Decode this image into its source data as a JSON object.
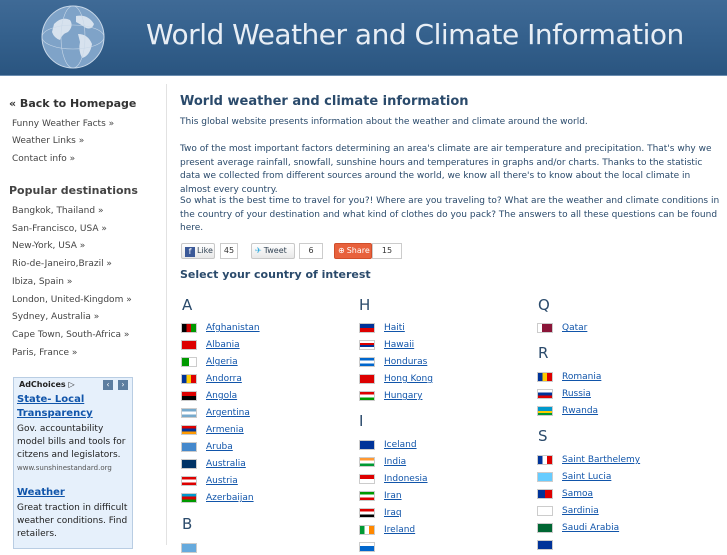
{
  "header": {
    "title": "World Weather and Climate Information"
  },
  "sidebar": {
    "back_link": "« Back to Homepage",
    "links": [
      "Funny Weather Facts »",
      "Weather Links »",
      "Contact info »"
    ],
    "popular_heading": "Popular destinations",
    "destinations": [
      "Bangkok, Thailand »",
      "San-Francisco, USA »",
      "New-York, USA »",
      "Rio-de-Janeiro,Brazil »",
      "Ibiza, Spain »",
      "London, United-Kingdom »",
      "Sydney, Australia »",
      "Cape Town, South-Africa »",
      "Paris, France »"
    ]
  },
  "ad": {
    "choices_label": "AdChoices ▷",
    "ad1_title_1": "State- Local",
    "ad1_title_2": "Transparency",
    "ad1_body": [
      "Gov. accountability",
      "model bills and tools for",
      "citzens and legislators."
    ],
    "ad1_url": "www.sunshinestandard.org",
    "ad2_title": "Weather",
    "ad2_body": [
      "Great traction in difficult",
      "weather conditions. Find",
      "retailers."
    ]
  },
  "main": {
    "title": "World weather and climate information",
    "intro": "This global website presents information about the weather and climate around the world.",
    "para2": "Two of the most important factors determining an area's climate are air temperature and precipitation. That's why we present average rainfall, snowfall, sunshine hours and temperatures in graphs and/or charts. Thanks to the statistic data we collected from different sources around the world, we know all there's to know about the local climate in almost every country.",
    "para3": "So what is the best time to travel for you?! Where are you traveling to? What are the weather and climate conditions in the country of your destination and what kind of clothes do you pack? The answers to all these questions can be found here.",
    "select_heading": "Select your country of interest"
  },
  "social": {
    "like_label": "Like",
    "like_count": "45",
    "tweet_label": "Tweet",
    "tweet_count": "6",
    "share_label": "Share",
    "share_count": "15"
  },
  "countries": {
    "col1_letters": [
      "A",
      "B"
    ],
    "col1_items": [
      "Afghanistan",
      "Albania",
      "Algeria",
      "Andorra",
      "Angola",
      "Argentina",
      "Armenia",
      "Aruba",
      "Australia",
      "Austria",
      "Azerbaijan"
    ],
    "col2_letters": [
      "H",
      "I"
    ],
    "col2_h": [
      "Haiti",
      "Hawaii",
      "Honduras",
      "Hong Kong",
      "Hungary"
    ],
    "col2_i": [
      "Iceland",
      "India",
      "Indonesia",
      "Iran",
      "Iraq",
      "Ireland"
    ],
    "col3_letters": [
      "Q",
      "R",
      "S"
    ],
    "col3_q": [
      "Qatar"
    ],
    "col3_r": [
      "Romania",
      "Russia",
      "Rwanda"
    ],
    "col3_s": [
      "Saint Barthelemy",
      "Saint Lucia",
      "Samoa",
      "Sardinia",
      "Saudi Arabia"
    ]
  },
  "colors": {
    "header_blue": "#34608c",
    "link_blue": "#1155aa",
    "heading_blue": "#2a4a6b"
  }
}
